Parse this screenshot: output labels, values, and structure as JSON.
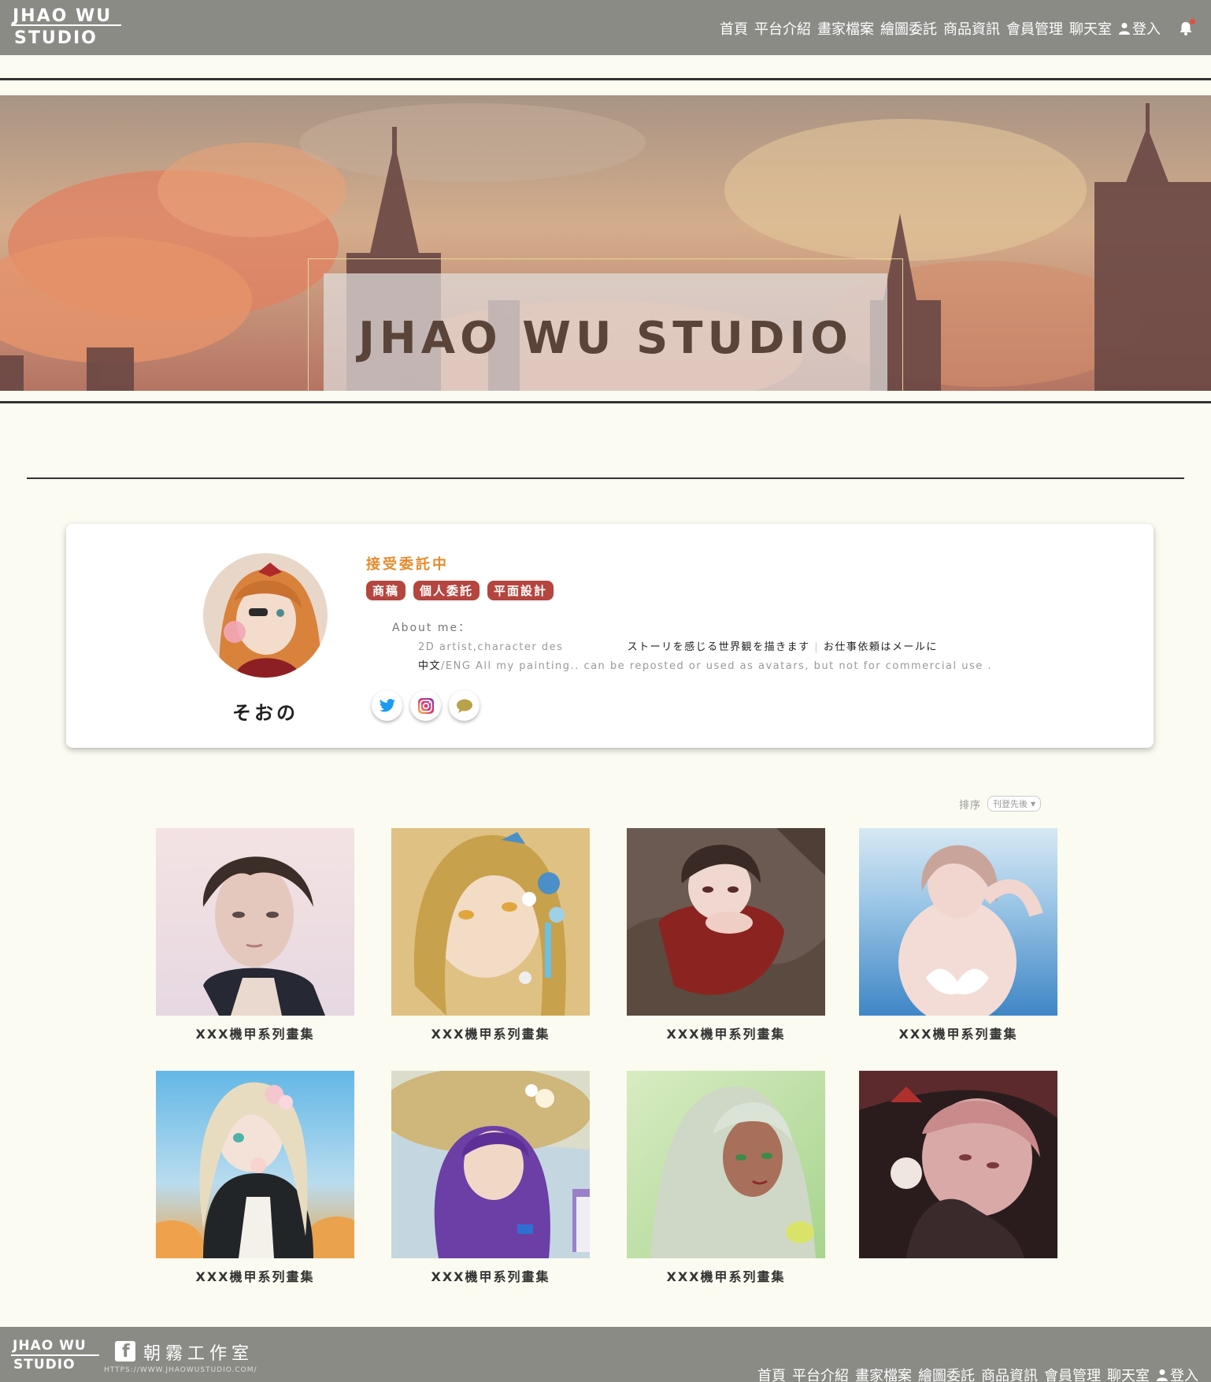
{
  "header": {
    "logo_line1": "JHAO WU",
    "logo_line2": "STUDIO",
    "nav": [
      "首頁",
      "平台介紹",
      "畫家檔案",
      "繪圖委託",
      "商品資訊",
      "會員管理",
      "聊天室"
    ],
    "login": "登入"
  },
  "hero": {
    "title": "JHAO WU STUDIO"
  },
  "profile": {
    "name": "そおの",
    "status": "接受委託中",
    "tags": [
      "商稿",
      "個人委託",
      "平面設計"
    ],
    "about_label": "About me：",
    "about_line1_a": "2D artist,character des",
    "about_line1_b": "ストーリを感じる世界観を描きます",
    "about_line1_c": "お仕事依頼はメールに",
    "about_line2_zh": "中文",
    "about_line2_rest": "/ENG All my painting.. can be reposted or used as avatars, but not for commercial use ."
  },
  "socials": [
    "twitter-icon",
    "instagram-icon",
    "chat-icon"
  ],
  "sort": {
    "label": "排序",
    "selected": "刊登先後"
  },
  "gallery": [
    {
      "caption": "XXX機甲系列畫集"
    },
    {
      "caption": "XXX機甲系列畫集"
    },
    {
      "caption": "XXX機甲系列畫集"
    },
    {
      "caption": "XXX機甲系列畫集"
    },
    {
      "caption": "XXX機甲系列畫集"
    },
    {
      "caption": "XXX機甲系列畫集"
    },
    {
      "caption": "XXX機甲系列畫集"
    },
    {
      "caption": ""
    }
  ],
  "footer": {
    "logo_line1": "JHAO WU",
    "logo_line2": "STUDIO",
    "studio_name": "朝霧工作室",
    "url": "HTTPS://WWW.JHAOWUSTUDIO.COM/",
    "nav": [
      "首頁",
      "平台介紹",
      "畫家檔案",
      "繪圖委託",
      "商品資訊",
      "會員管理",
      "聊天室"
    ],
    "login": "登入"
  },
  "colors": {
    "header_bg": "#8a8b85",
    "page_bg": "#fbfbf1",
    "status": "#e88a2d",
    "tag": "#b5453f",
    "hero_text": "#5a4439"
  }
}
